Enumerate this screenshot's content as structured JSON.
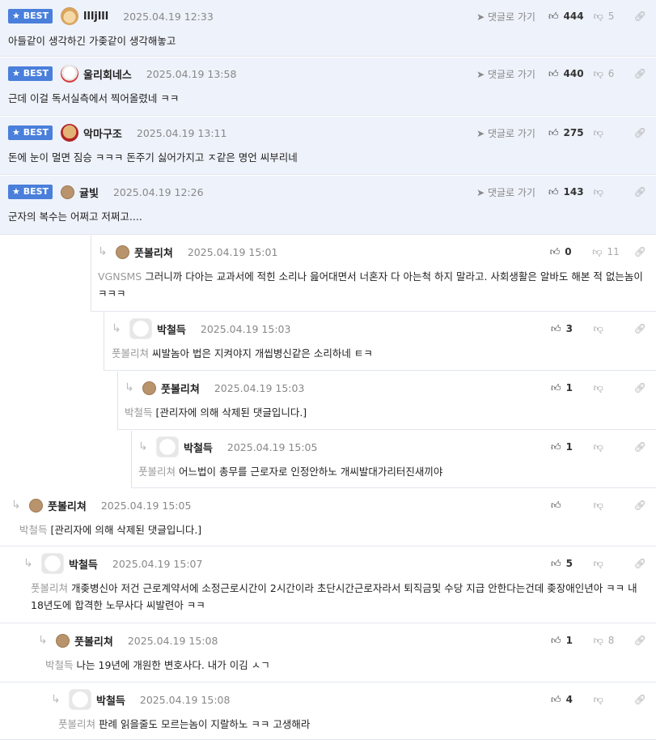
{
  "ui": {
    "best_label": "BEST",
    "goto_label": "댓글로 가기",
    "deleted_text": "[관리자에 의해 삭제된 댓글입니다.]"
  },
  "comments": [
    {
      "best": true,
      "depth": 0,
      "avatar": "puppy-avatar",
      "nick": "llljlll",
      "date": "2025.04.19 12:33",
      "likes": "444",
      "dislikes": "5",
      "mention": "",
      "text": "아들같이 생각하긴 가좆같이 생각해놓고"
    },
    {
      "best": true,
      "depth": 0,
      "avatar": "polar-bear-avatar",
      "nick": "울리회네스",
      "date": "2025.04.19 13:58",
      "likes": "440",
      "dislikes": "6",
      "mention": "",
      "text": "근데 이걸 독서실측에서 찍어올렸네 ㅋㅋ"
    },
    {
      "best": true,
      "depth": 0,
      "avatar": "dog-cape-avatar",
      "nick": "악마구조",
      "date": "2025.04.19 13:11",
      "likes": "275",
      "dislikes": "",
      "mention": "",
      "text": "돈에 눈이 멀면 짐승 ㅋㅋㅋ 돈주기 싫어가지고 ㅈ같은 명언 씨부리네"
    },
    {
      "best": true,
      "depth": 0,
      "avatar": "dot-avatar",
      "nick": "귤빛",
      "date": "2025.04.19 12:26",
      "likes": "143",
      "dislikes": "",
      "mention": "",
      "text": "군자의 복수는 어쩌고 저쩌고...."
    },
    {
      "best": false,
      "depth": 1,
      "avatar": "dot-avatar",
      "nick": "풋볼리쳐",
      "date": "2025.04.19 15:01",
      "likes": "0",
      "dislikes": "11",
      "mention": "VGNSMS",
      "text": "그러니까 다아는 교과서에 적힌 소리나 읊어대면서 너혼자 다 아는척 하지 말라고. 사회생활은 알바도 해본 적 없는놈이 ㅋㅋㅋ"
    },
    {
      "best": false,
      "depth": 2,
      "avatar": "samoyed-avatar",
      "nick": "박철득",
      "date": "2025.04.19 15:03",
      "likes": "3",
      "dislikes": "",
      "mention": "풋볼리쳐",
      "text": "씨발놈아 법은 지켜야지 개씹병신같은 소리하네 ㅌㅋ"
    },
    {
      "best": false,
      "depth": 3,
      "avatar": "dot-avatar",
      "nick": "풋볼리쳐",
      "date": "2025.04.19 15:03",
      "likes": "1",
      "dislikes": "",
      "mention": "박철득",
      "text": "[관리자에 의해 삭제된 댓글입니다.]"
    },
    {
      "best": false,
      "depth": 4,
      "avatar": "samoyed-avatar",
      "nick": "박철득",
      "date": "2025.04.19 15:05",
      "likes": "1",
      "dislikes": "",
      "mention": "풋볼리쳐",
      "text": "어느법이 총무를 근로자로 인정안하노 개씨발대가리터진새끼야"
    },
    {
      "best": false,
      "depth": 5,
      "avatar": "dot-avatar",
      "nick": "풋볼리쳐",
      "date": "2025.04.19 15:05",
      "likes": "",
      "dislikes": "",
      "mention": "박철득",
      "text": "[관리자에 의해 삭제된 댓글입니다.]"
    },
    {
      "best": false,
      "depth": 6,
      "avatar": "samoyed-avatar",
      "nick": "박철득",
      "date": "2025.04.19 15:07",
      "likes": "5",
      "dislikes": "",
      "mention": "풋볼리쳐",
      "text": "개좆병신아 저건 근로계약서에 소정근로시간이 2시간이라 초단시간근로자라서 퇴직금및 수당 지급 안한다는건데 좆장애인년아 ㅋㅋ 내 18년도에 합격한 노무사다 씨발련아 ㅋㅋ"
    },
    {
      "best": false,
      "depth": 7,
      "avatar": "dot-avatar",
      "nick": "풋볼리쳐",
      "date": "2025.04.19 15:08",
      "likes": "1",
      "dislikes": "8",
      "mention": "박철득",
      "text": "나는 19년에 개원한 변호사다. 내가 이김 ㅅㄱ"
    },
    {
      "best": false,
      "depth": 8,
      "avatar": "samoyed-avatar",
      "nick": "박철득",
      "date": "2025.04.19 15:08",
      "likes": "4",
      "dislikes": "",
      "mention": "풋볼리쳐",
      "text": "판례 읽을줄도 모르는놈이 지랄하노 ㅋㅋ 고생해라"
    }
  ]
}
